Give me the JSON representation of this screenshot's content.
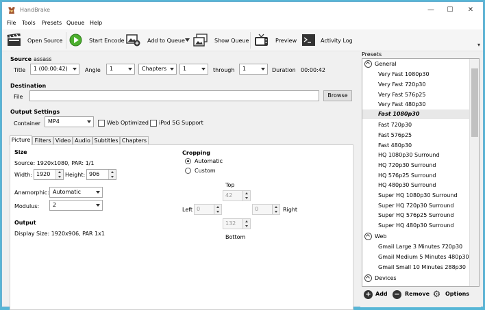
{
  "window": {
    "title": "HandBrake",
    "minimize": "—",
    "maximize": "☐",
    "close": "✕"
  },
  "menu": [
    "File",
    "Tools",
    "Presets",
    "Queue",
    "Help"
  ],
  "toolbar": {
    "open_source": "Open Source",
    "start_encode": "Start Encode",
    "add_to_queue": "Add to Queue",
    "show_queue": "Show Queue",
    "preview": "Preview",
    "activity_log": "Activity Log"
  },
  "source": {
    "label": "Source",
    "name": "assass",
    "title_label": "Title",
    "title_value": "1 (00:00:42)",
    "angle_label": "Angle",
    "angle_value": "1",
    "range_type": "Chapters",
    "range_start": "1",
    "through_label": "through",
    "range_end": "1",
    "duration_label": "Duration",
    "duration_value": "00:00:42"
  },
  "destination": {
    "label": "Destination",
    "file_label": "File",
    "file_value": "",
    "browse": "Browse"
  },
  "output_settings": {
    "label": "Output Settings",
    "container_label": "Container",
    "container_value": "MP4",
    "web_optimized": "Web Optimized",
    "ipod_support": "iPod 5G Support"
  },
  "tabs": [
    "Picture",
    "Filters",
    "Video",
    "Audio",
    "Subtitles",
    "Chapters"
  ],
  "picture": {
    "size_label": "Size",
    "source_line": "Source:  1920x1080, PAR: 1/1",
    "width_label": "Width:",
    "width_value": "1920",
    "height_label": "Height:",
    "height_value": "906",
    "anamorphic_label": "Anamorphic:",
    "anamorphic_value": "Automatic",
    "modulus_label": "Modulus:",
    "modulus_value": "2",
    "output_label": "Output",
    "display_size": "Display Size: 1920x906,  PAR 1x1",
    "cropping_label": "Cropping",
    "automatic": "Automatic",
    "custom": "Custom",
    "top_label": "Top",
    "top_value": "42",
    "left_label": "Left",
    "left_value": "0",
    "right_label": "Right",
    "right_value": "0",
    "bottom_label": "Bottom",
    "bottom_value": "132"
  },
  "presets": {
    "label": "Presets",
    "groups": [
      {
        "name": "General",
        "items": [
          "Very Fast 1080p30",
          "Very Fast 720p30",
          "Very Fast 576p25",
          "Very Fast 480p30",
          "Fast 1080p30",
          "Fast 720p30",
          "Fast 576p25",
          "Fast 480p30",
          "HQ 1080p30 Surround",
          "HQ 720p30 Surround",
          "HQ 576p25 Surround",
          "HQ 480p30 Surround",
          "Super HQ 1080p30 Surround",
          "Super HQ 720p30 Surround",
          "Super HQ 576p25 Surround",
          "Super HQ 480p30 Surround"
        ]
      },
      {
        "name": "Web",
        "items": [
          "Gmail Large 3 Minutes 720p30",
          "Gmail Medium 5 Minutes 480p30",
          "Gmail Small 10 Minutes 288p30"
        ]
      },
      {
        "name": "Devices",
        "items": []
      }
    ],
    "selected": "Fast 1080p30",
    "add": "Add",
    "remove": "Remove",
    "options": "Options"
  }
}
